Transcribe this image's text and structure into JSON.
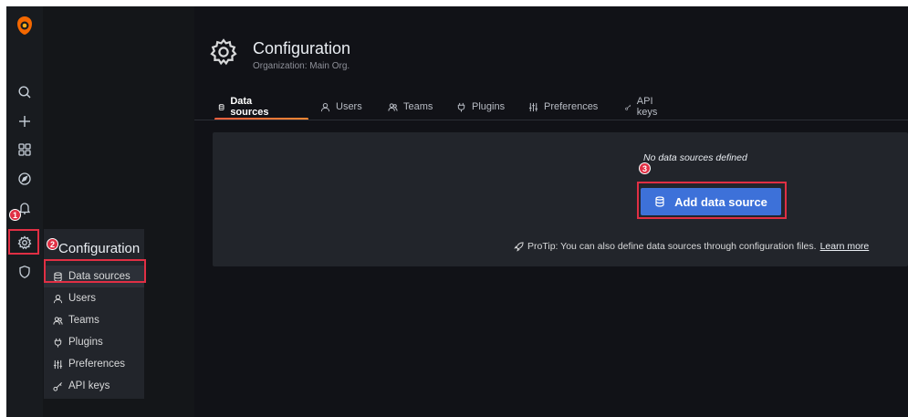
{
  "header": {
    "title": "Configuration",
    "subtitle": "Organization: Main Org."
  },
  "tabs": [
    {
      "label": "Data sources",
      "icon": "database-icon",
      "active": true
    },
    {
      "label": "Users",
      "icon": "user-icon"
    },
    {
      "label": "Teams",
      "icon": "users-icon"
    },
    {
      "label": "Plugins",
      "icon": "plug-icon"
    },
    {
      "label": "Preferences",
      "icon": "sliders-icon"
    },
    {
      "label": "API keys",
      "icon": "key-icon"
    }
  ],
  "flyout": {
    "title": "Configuration",
    "items": [
      {
        "label": "Data sources",
        "icon": "database-icon"
      },
      {
        "label": "Users",
        "icon": "user-icon"
      },
      {
        "label": "Teams",
        "icon": "users-icon"
      },
      {
        "label": "Plugins",
        "icon": "plug-icon"
      },
      {
        "label": "Preferences",
        "icon": "sliders-icon"
      },
      {
        "label": "API keys",
        "icon": "key-icon"
      }
    ]
  },
  "rail": {
    "items": [
      "grafana-logo-icon",
      "search-icon",
      "plus-icon",
      "dashboards-icon",
      "explore-icon",
      "alerting-icon",
      "gear-icon",
      "shield-icon"
    ]
  },
  "main": {
    "empty_text": "No data sources defined",
    "add_button": "Add data source",
    "protip": "ProTip: You can also define data sources through configuration files.",
    "learn_more": "Learn more"
  },
  "annotations": {
    "badge1": "1",
    "badge2": "2",
    "badge3": "3"
  },
  "colors": {
    "accent": "#3d71d9",
    "highlight": "#e02f44",
    "tab_underline": "#f55f3e"
  }
}
